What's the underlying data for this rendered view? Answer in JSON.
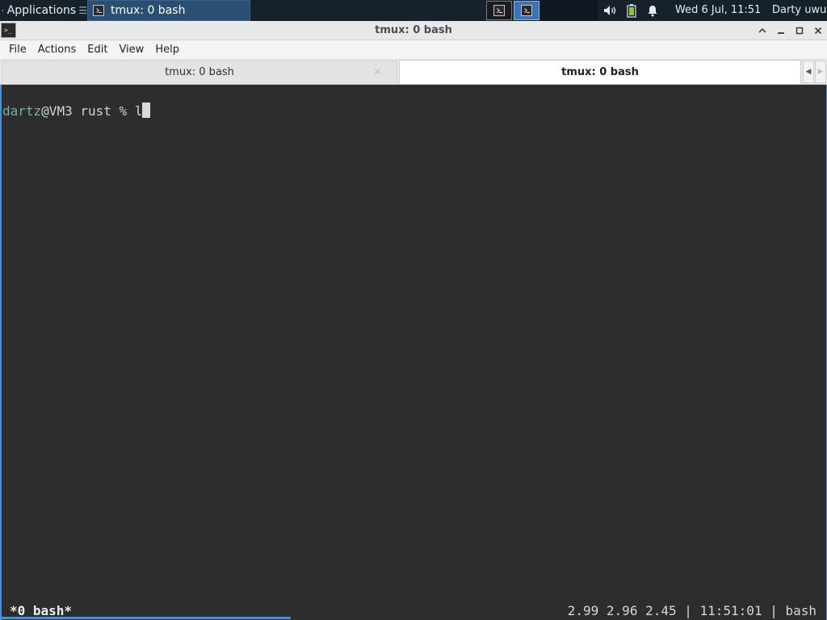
{
  "panel": {
    "applications_label": "Applications",
    "applications_trail": "☰",
    "task_title": "tmux: 0 bash",
    "clock": "Wed  6 Jul, 11:51",
    "user": "Darty uwu"
  },
  "window": {
    "title": "tmux: 0 bash"
  },
  "menu": {
    "file": "File",
    "actions": "Actions",
    "edit": "Edit",
    "view": "View",
    "help": "Help"
  },
  "tabs": [
    {
      "label": "tmux: 0 bash",
      "active": false
    },
    {
      "label": "tmux: 0 bash",
      "active": true
    }
  ],
  "terminal": {
    "prompt_user": "dartz",
    "prompt_rest": "@VM3 rust % ",
    "typed": "l",
    "status_left": "*0 bash*",
    "status_right": "2.99 2.96 2.45 | 11:51:01 | bash"
  },
  "colors": {
    "panel_bg": "#16212b",
    "terminal_bg": "#2d2d2d",
    "prompt_user": "#6fb3a4",
    "accent": "#4a90d9"
  },
  "icons": {
    "apps": "xfce-mouse-icon",
    "volume": "volume-icon",
    "battery": "battery-icon",
    "notification": "bell-icon"
  }
}
